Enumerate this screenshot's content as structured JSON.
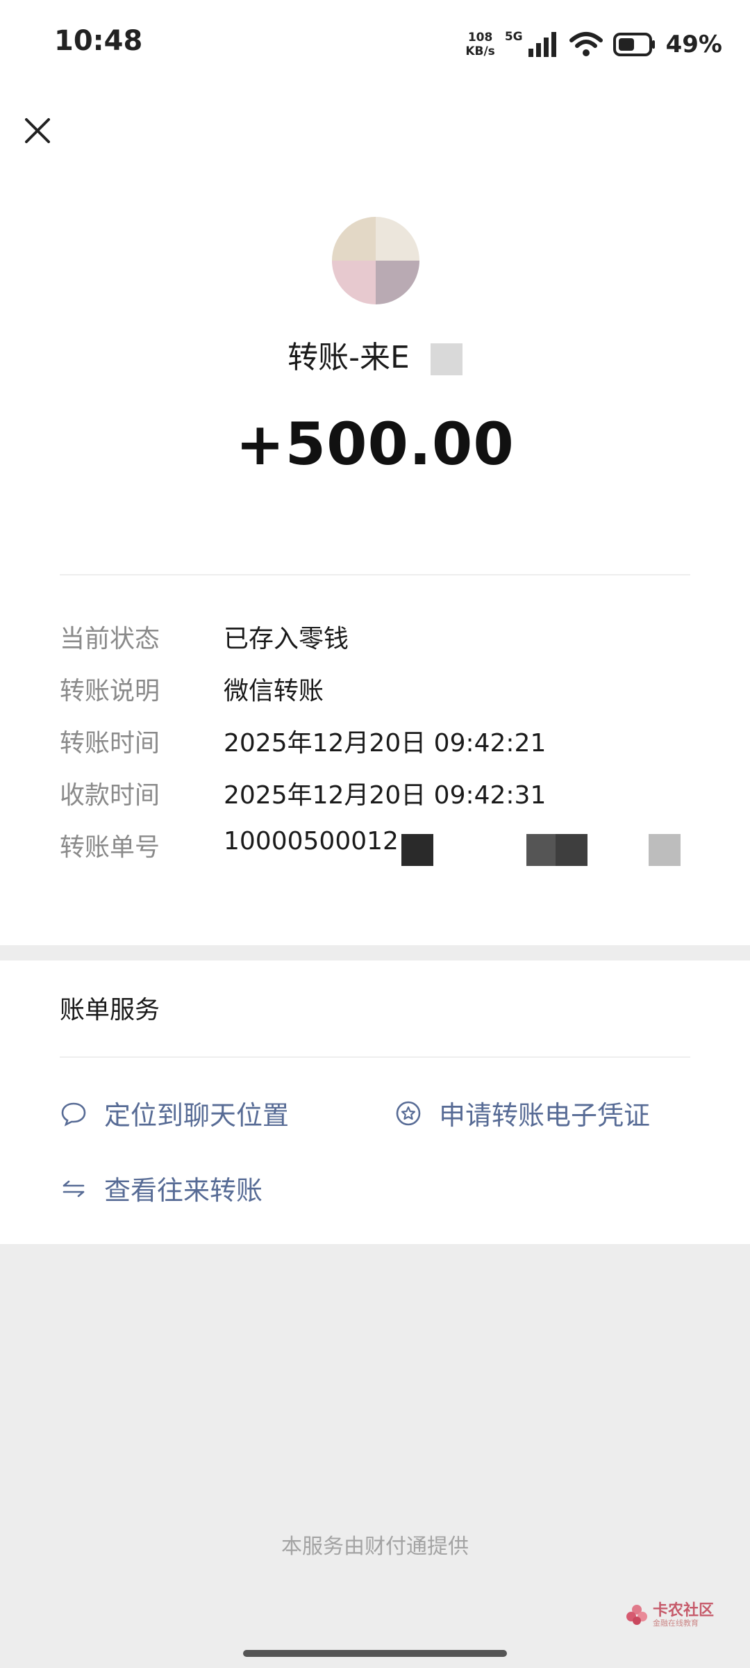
{
  "status_bar": {
    "time": "10:48",
    "net_speed_value": "108",
    "net_speed_unit": "KB/s",
    "network_type": "5G",
    "battery_percent": "49%"
  },
  "header": {
    "close_icon": "close-icon"
  },
  "transfer": {
    "title": "转账-来E",
    "amount": "+500.00"
  },
  "details": [
    {
      "label": "当前状态",
      "value": "已存入零钱"
    },
    {
      "label": "转账说明",
      "value": "微信转账"
    },
    {
      "label": "转账时间",
      "value": "2025年12月20日 09:42:21"
    },
    {
      "label": "收款时间",
      "value": "2025年12月20日 09:42:31"
    },
    {
      "label": "转账单号",
      "value": "10000500012"
    }
  ],
  "bill_service": {
    "title": "账单服务",
    "links": [
      {
        "label": "定位到聊天位置",
        "icon": "chat-bubble-icon"
      },
      {
        "label": "申请转账电子凭证",
        "icon": "star-badge-icon"
      },
      {
        "label": "查看往来转账",
        "icon": "swap-arrows-icon"
      }
    ]
  },
  "footer": {
    "note": "本服务由财付通提供",
    "watermark_main": "卡农社区",
    "watermark_sub": "金融在线教育"
  },
  "colors": {
    "link": "#576b95",
    "label": "#8a8a8a",
    "page_bg": "#ededed"
  }
}
